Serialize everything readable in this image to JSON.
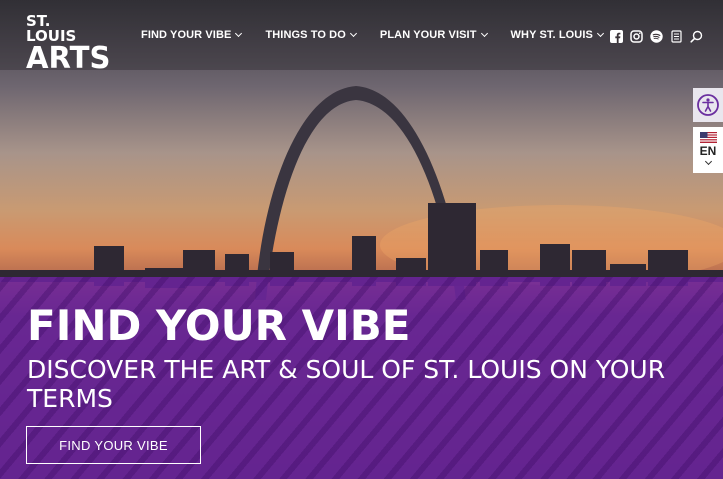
{
  "brand": {
    "logo_line1": "ST. LOUIS",
    "logo_line2": "ARTS"
  },
  "nav": {
    "items": [
      {
        "label": "FIND YOUR VIBE"
      },
      {
        "label": "THINGS TO DO"
      },
      {
        "label": "PLAN YOUR VISIT"
      },
      {
        "label": "WHY ST. LOUIS"
      }
    ]
  },
  "socials": [
    "facebook-icon",
    "instagram-icon",
    "spotify-icon",
    "newsletter-icon",
    "search-icon"
  ],
  "language": {
    "code": "EN",
    "flag": "us-flag-icon"
  },
  "hero": {
    "title": "FIND YOUR VIBE",
    "subtitle": "DISCOVER THE ART & SOUL OF ST. LOUIS ON YOUR TERMS",
    "cta_label": "FIND YOUR VIBE"
  },
  "colors": {
    "overlay": "#6e24a0",
    "text": "#ffffff",
    "a11y_icon": "#6b2fa0"
  }
}
